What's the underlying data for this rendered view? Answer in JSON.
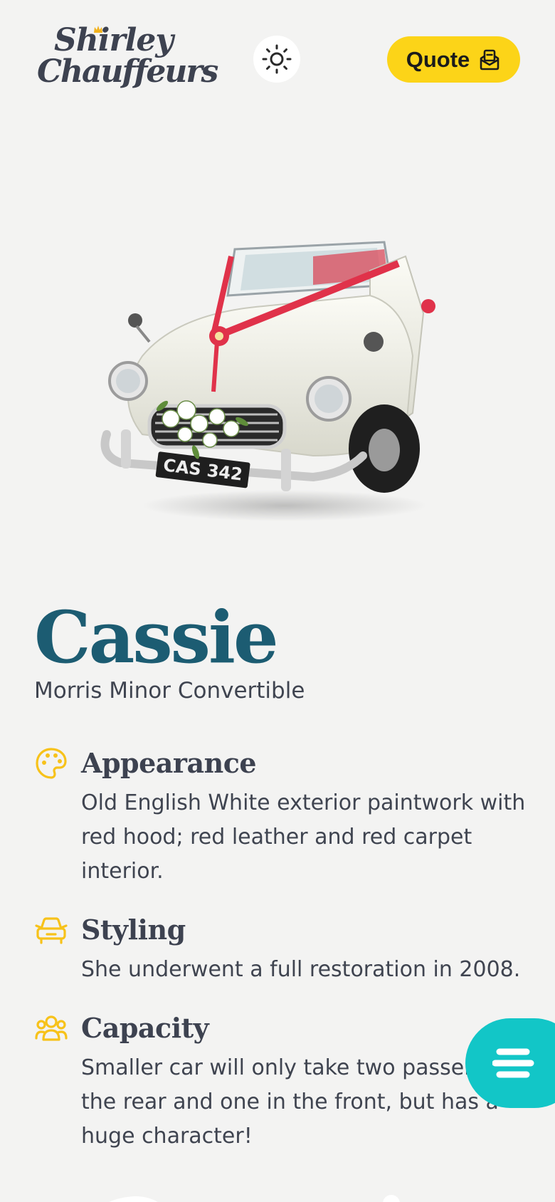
{
  "header": {
    "logo_line1": "Shirley",
    "logo_line2": "Chauffeurs",
    "theme_toggle_icon": "sun-icon",
    "quote_label": "Quote",
    "quote_icon": "mail-open-icon",
    "quote_color": "#fcd418"
  },
  "car": {
    "plate": "CAS 342",
    "name": "Cassie",
    "model": "Morris Minor Convertible"
  },
  "features": [
    {
      "icon": "palette-icon",
      "title": "Appearance",
      "text": "Old English White exterior paintwork with red hood; red leather and red carpet interior."
    },
    {
      "icon": "car-icon",
      "title": "Styling",
      "text": "She underwent a full restoration in 2008."
    },
    {
      "icon": "users-icon",
      "title": "Capacity",
      "text": "Smaller car will only take two passengers in the rear and one in the front, but has a huge character!"
    }
  ],
  "menu_button": {
    "icon": "menu-icon",
    "color": "#12c6c7"
  },
  "colors": {
    "accent": "#fcd418",
    "title": "#1c5c72",
    "background": "#f3f3f2"
  }
}
